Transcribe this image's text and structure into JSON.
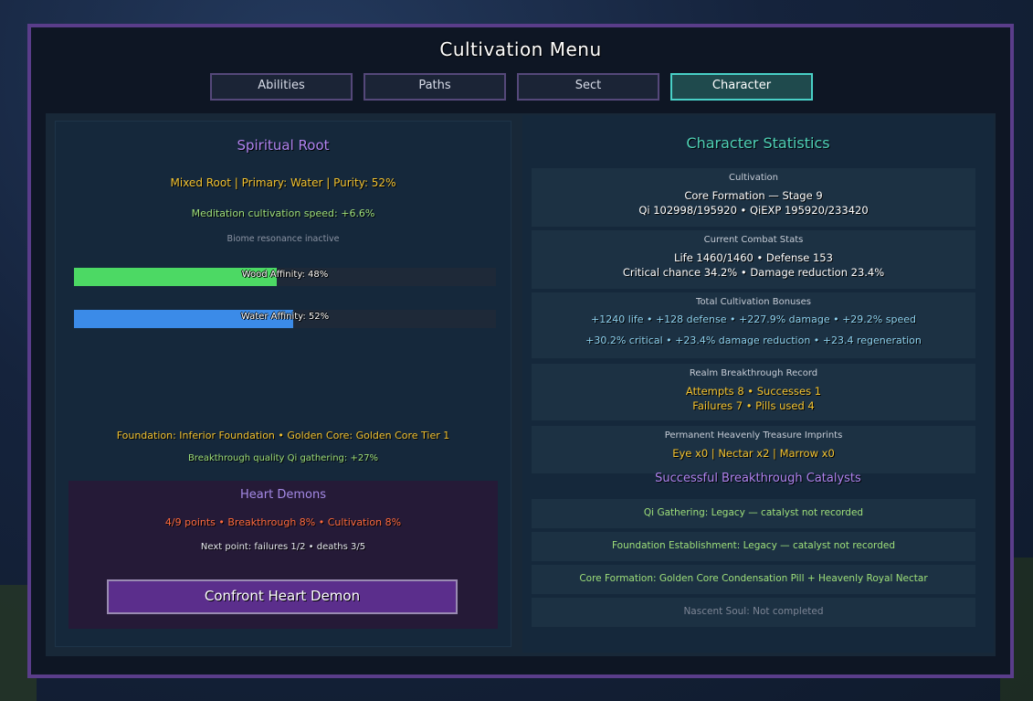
{
  "window": {
    "title": "Cultivation Menu"
  },
  "tabs": [
    {
      "label": "Abilities",
      "active": false
    },
    {
      "label": "Paths",
      "active": false
    },
    {
      "label": "Sect",
      "active": false
    },
    {
      "label": "Character",
      "active": true
    }
  ],
  "spiritual_root": {
    "title": "Spiritual Root",
    "summary": "Mixed Root | Primary: Water | Purity: 52%",
    "meditation": "Meditation cultivation speed: +6.6%",
    "biome": "Biome resonance inactive",
    "affinities": [
      {
        "label": "Wood Affinity: 48%",
        "value": 48,
        "color": "#4cd964"
      },
      {
        "label": "Water Affinity: 52%",
        "value": 52,
        "color": "#3b8be8"
      }
    ],
    "foundation": "Foundation: Inferior Foundation  •  Golden Core: Golden Core Tier 1",
    "breakthrough_quality": "Breakthrough quality Qi gathering: +27%"
  },
  "heart_demons": {
    "title": "Heart Demons",
    "stats": "4/9 points  •  Breakthrough 8%  •  Cultivation 8%",
    "next_point": "Next point: failures 1/2  •  deaths 3/5",
    "button_label": "Confront Heart Demon"
  },
  "character_stats": {
    "title": "Character Statistics",
    "cultivation": {
      "caption": "Cultivation",
      "line1": "Core Formation — Stage 9",
      "line2": "Qi 102998/195920  •  QiEXP 195920/233420"
    },
    "combat": {
      "caption": "Current Combat Stats",
      "line1": "Life 1460/1460  •  Defense 153",
      "line2": "Critical chance 34.2%  •  Damage reduction 23.4%"
    },
    "bonuses": {
      "caption": "Total Cultivation Bonuses",
      "line1": "+1240 life  •  +128 defense  •  +227.9% damage  •  +29.2% speed",
      "line2": "+30.2% critical  •  +23.4% damage reduction  •  +23.4 regeneration"
    },
    "breakthrough_record": {
      "caption": "Realm Breakthrough Record",
      "line1": "Attempts 8  •  Successes 1",
      "line2": "Failures 7  •  Pills used 4"
    },
    "imprints": {
      "caption": "Permanent Heavenly Treasure Imprints",
      "line1": "Eye x0 | Nectar x2 | Marrow x0"
    },
    "catalysts_title": "Successful Breakthrough Catalysts",
    "catalysts": [
      {
        "text": "Qi Gathering: Legacy — catalyst not recorded",
        "done": true
      },
      {
        "text": "Foundation Establishment: Legacy — catalyst not recorded",
        "done": true
      },
      {
        "text": "Core Formation: Golden Core Condensation Pill + Heavenly Royal Nectar",
        "done": true
      },
      {
        "text": "Nascent Soul: Not completed",
        "done": false
      }
    ]
  }
}
